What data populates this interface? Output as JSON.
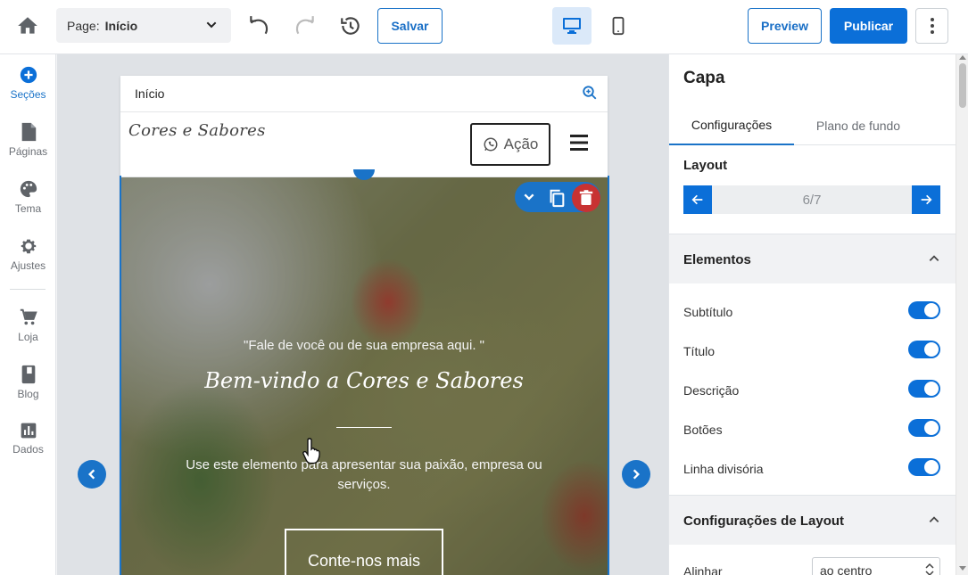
{
  "topbar": {
    "page_prefix": "Page:",
    "page_name": "Início",
    "save_label": "Salvar",
    "preview_label": "Preview",
    "publish_label": "Publicar"
  },
  "leftnav": {
    "items": [
      {
        "label": "Seções",
        "icon": "plus-circle-icon",
        "active": true
      },
      {
        "label": "Páginas",
        "icon": "file-icon"
      },
      {
        "label": "Tema",
        "icon": "palette-icon"
      },
      {
        "label": "Ajustes",
        "icon": "gear-icon"
      },
      {
        "label": "Loja",
        "icon": "cart-icon"
      },
      {
        "label": "Blog",
        "icon": "book-icon"
      },
      {
        "label": "Dados",
        "icon": "chart-icon"
      }
    ]
  },
  "preview": {
    "page_label": "Início",
    "site_logo": "Cores e Sabores",
    "action_button": "Ação",
    "hero": {
      "subtitle": "\"Fale de você ou de sua empresa aqui. \"",
      "title": "Bem-vindo a Cores e Sabores",
      "description": "Use este elemento para apresentar sua paixão, empresa ou serviços.",
      "cta": "Conte-nos mais"
    }
  },
  "panel": {
    "title": "Capa",
    "tabs": [
      "Configurações",
      "Plano de fundo"
    ],
    "layout_label": "Layout",
    "layout_value": "6/7",
    "elements_label": "Elementos",
    "toggles": [
      {
        "label": "Subtítulo",
        "on": true
      },
      {
        "label": "Título",
        "on": true
      },
      {
        "label": "Descrição",
        "on": true
      },
      {
        "label": "Botões",
        "on": true
      },
      {
        "label": "Linha divisória",
        "on": true
      }
    ],
    "layout_settings_label": "Configurações de Layout",
    "align_label": "Alinhar",
    "align_value": "ao centro"
  },
  "colors": {
    "accent": "#0b6fd8",
    "danger": "#c83232"
  }
}
